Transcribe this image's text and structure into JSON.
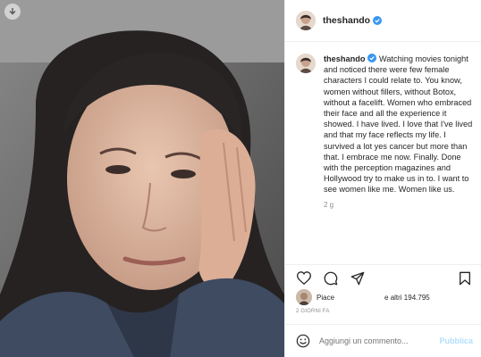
{
  "colors": {
    "verified": "#3897f0",
    "text": "#262626",
    "muted": "#8e8e8e",
    "publish_disabled": "#b2dffc",
    "divider": "#efefef"
  },
  "post": {
    "username": "theshando",
    "image_alt_icon": "download-icon",
    "caption": {
      "author": "theshando",
      "text": "Watching movies tonight and noticed there were few female characters I could relate to. You know, women without fillers, without Botox, without a facelift. Women who embraced their face and all the experience it showed. I have lived. I love that I've lived and that my face reflects my life. I survived a lot yes cancer but more than that. I embrace me now. Finally. Done with the perception magazines and Hollywood try to make us in to. I want to see women like me. Women like us.",
      "time_ago": "2 g"
    },
    "actions": {
      "like_icon": "heart-icon",
      "comment_icon": "comment-icon",
      "share_icon": "share-icon",
      "save_icon": "bookmark-icon"
    },
    "likes": {
      "prefix": "Piace",
      "suffix": "e altri 194.795"
    },
    "date": "2 GIORNI FA",
    "comment": {
      "emoji_icon": "emoji-icon",
      "placeholder": "Aggiungi un commento...",
      "publish_label": "Pubblica"
    }
  }
}
